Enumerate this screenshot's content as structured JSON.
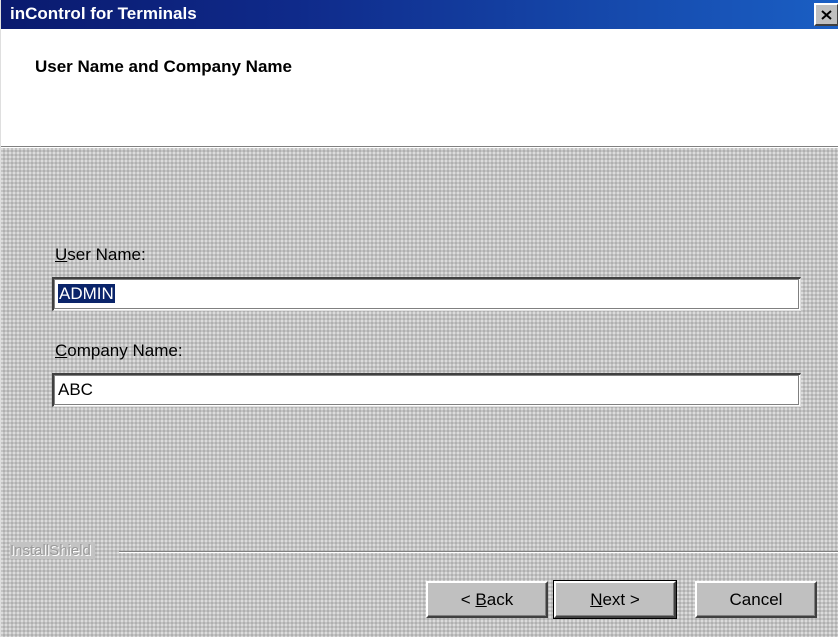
{
  "window": {
    "title": "inControl for Terminals",
    "close_icon": "close-icon"
  },
  "header": {
    "title": "User Name and Company Name"
  },
  "form": {
    "user_name": {
      "label_mnemonic": "U",
      "label_rest": "ser Name:",
      "value": "ADMIN",
      "selected": true
    },
    "company_name": {
      "label_mnemonic": "C",
      "label_rest": "ompany Name:",
      "value": "ABC"
    }
  },
  "footer": {
    "brand": "InstallShield",
    "back": {
      "prefix": "< ",
      "mnemonic": "B",
      "rest": "ack"
    },
    "next": {
      "prefix": "",
      "mnemonic": "N",
      "rest": "ext >"
    },
    "cancel": "Cancel"
  },
  "colors": {
    "titlebar_start": "#0a1a6e",
    "titlebar_end": "#1a5fc4",
    "face": "#c0c0c0",
    "selection": "#0a246a"
  }
}
